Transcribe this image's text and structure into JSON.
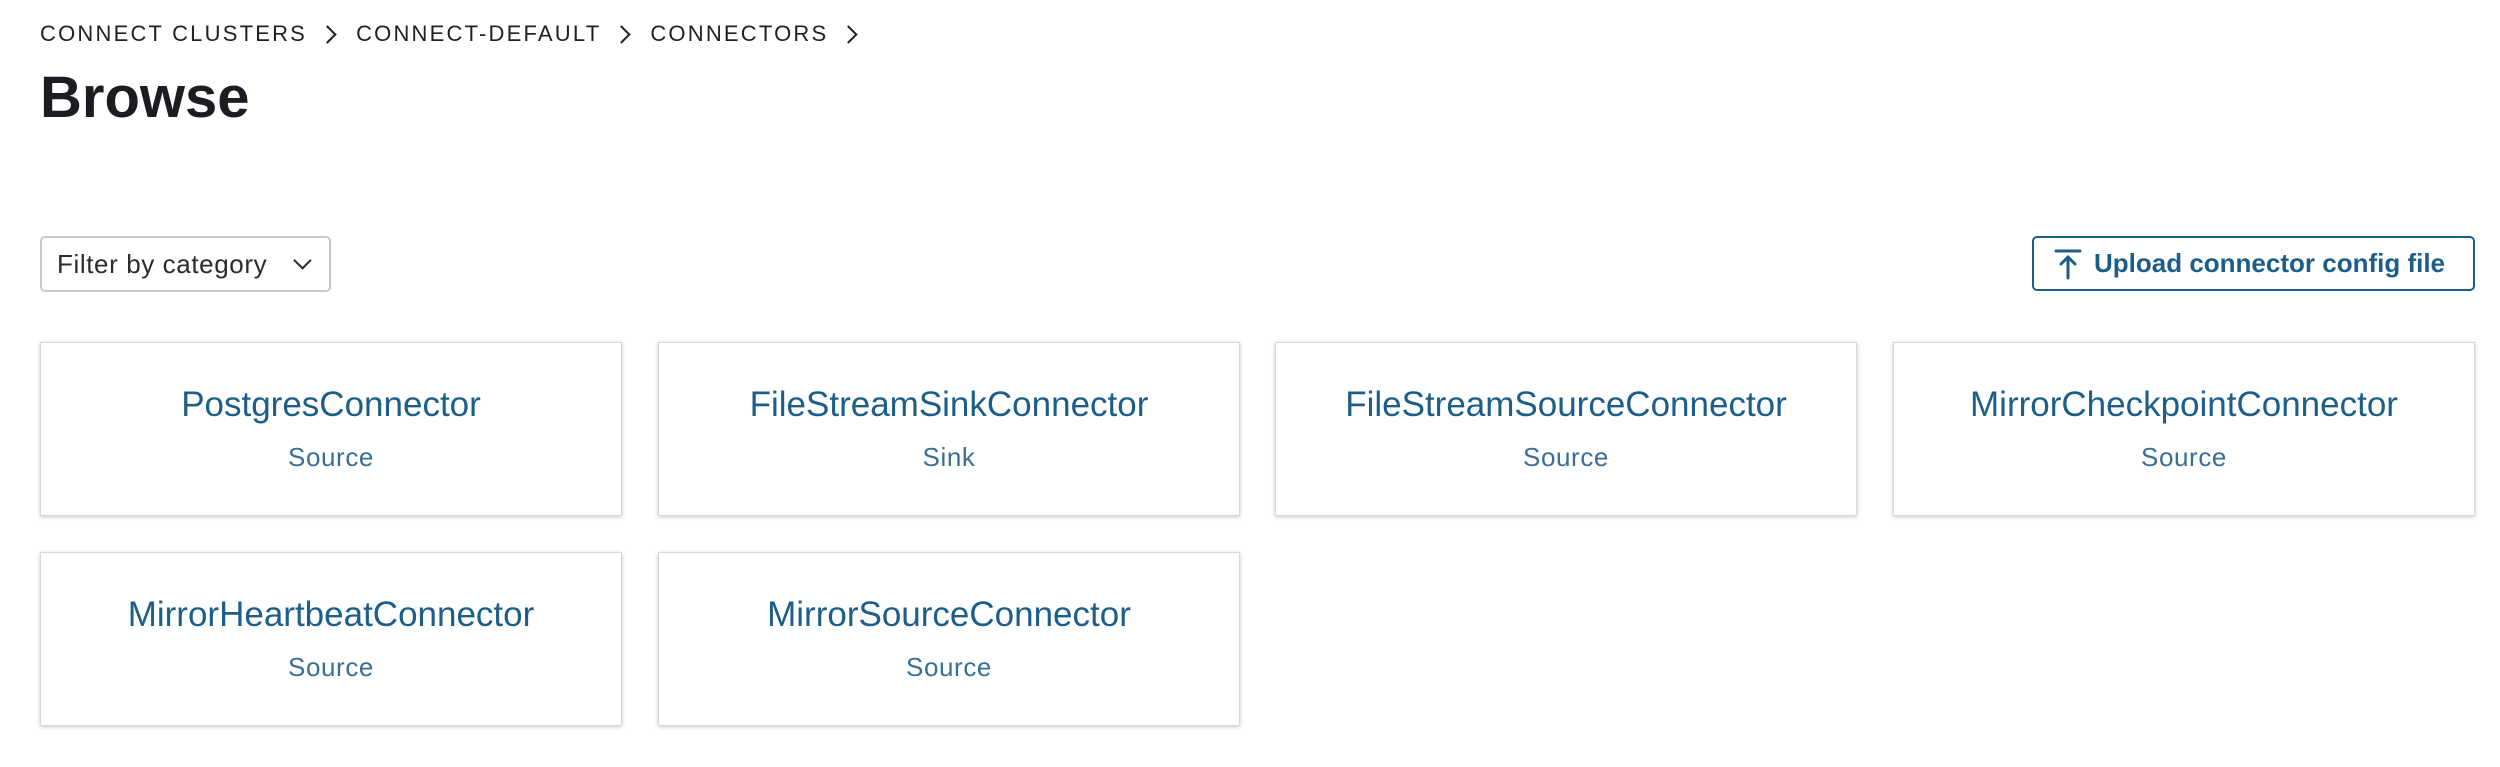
{
  "breadcrumb": {
    "items": [
      {
        "label": "CONNECT CLUSTERS"
      },
      {
        "label": "CONNECT-DEFAULT"
      },
      {
        "label": "CONNECTORS"
      }
    ]
  },
  "page": {
    "title": "Browse"
  },
  "toolbar": {
    "filter_label": "Filter by category",
    "upload_label": "Upload connector config file",
    "upload_icon": "upload-icon"
  },
  "connectors": [
    {
      "name": "PostgresConnector",
      "type": "Source"
    },
    {
      "name": "FileStreamSinkConnector",
      "type": "Sink"
    },
    {
      "name": "FileStreamSourceConnector",
      "type": "Source"
    },
    {
      "name": "MirrorCheckpointConnector",
      "type": "Source"
    },
    {
      "name": "MirrorHeartbeatConnector",
      "type": "Source"
    },
    {
      "name": "MirrorSourceConnector",
      "type": "Source"
    }
  ],
  "colors": {
    "accent": "#1d5e89",
    "text": "#1f1f24",
    "border": "#c8c8cc"
  }
}
